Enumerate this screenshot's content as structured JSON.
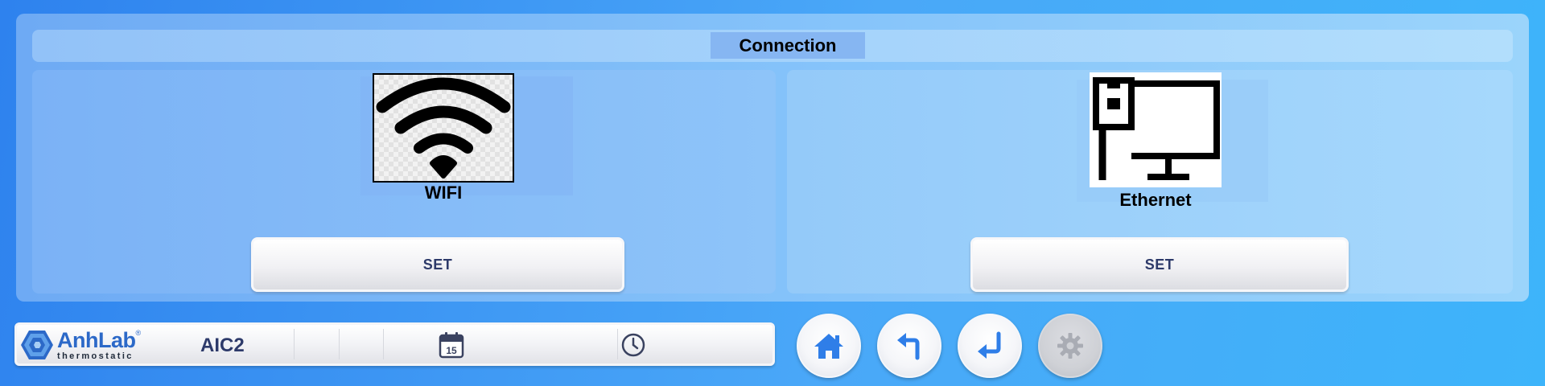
{
  "title": "Connection",
  "wifi": {
    "label": "WIFI",
    "set_label": "SET",
    "icon": "wifi-icon"
  },
  "ethernet": {
    "label": "Ethernet",
    "set_label": "SET",
    "icon": "ethernet-icon"
  },
  "status_bar": {
    "brand": "AnhLab",
    "brand_mark": "®",
    "brand_sub": "thermostatic",
    "device": "AIC2",
    "date": "",
    "time": "",
    "calendar_icon_text": "15"
  },
  "nav": {
    "home_icon": "home-icon",
    "back_icon": "undo-arrow-icon",
    "enter_icon": "enter-arrow-icon",
    "settings_icon": "gear-icon",
    "settings_enabled": false
  },
  "colors": {
    "accent": "#2c69c8",
    "button_text": "#2d3a6a",
    "background": "#3d9af5"
  }
}
